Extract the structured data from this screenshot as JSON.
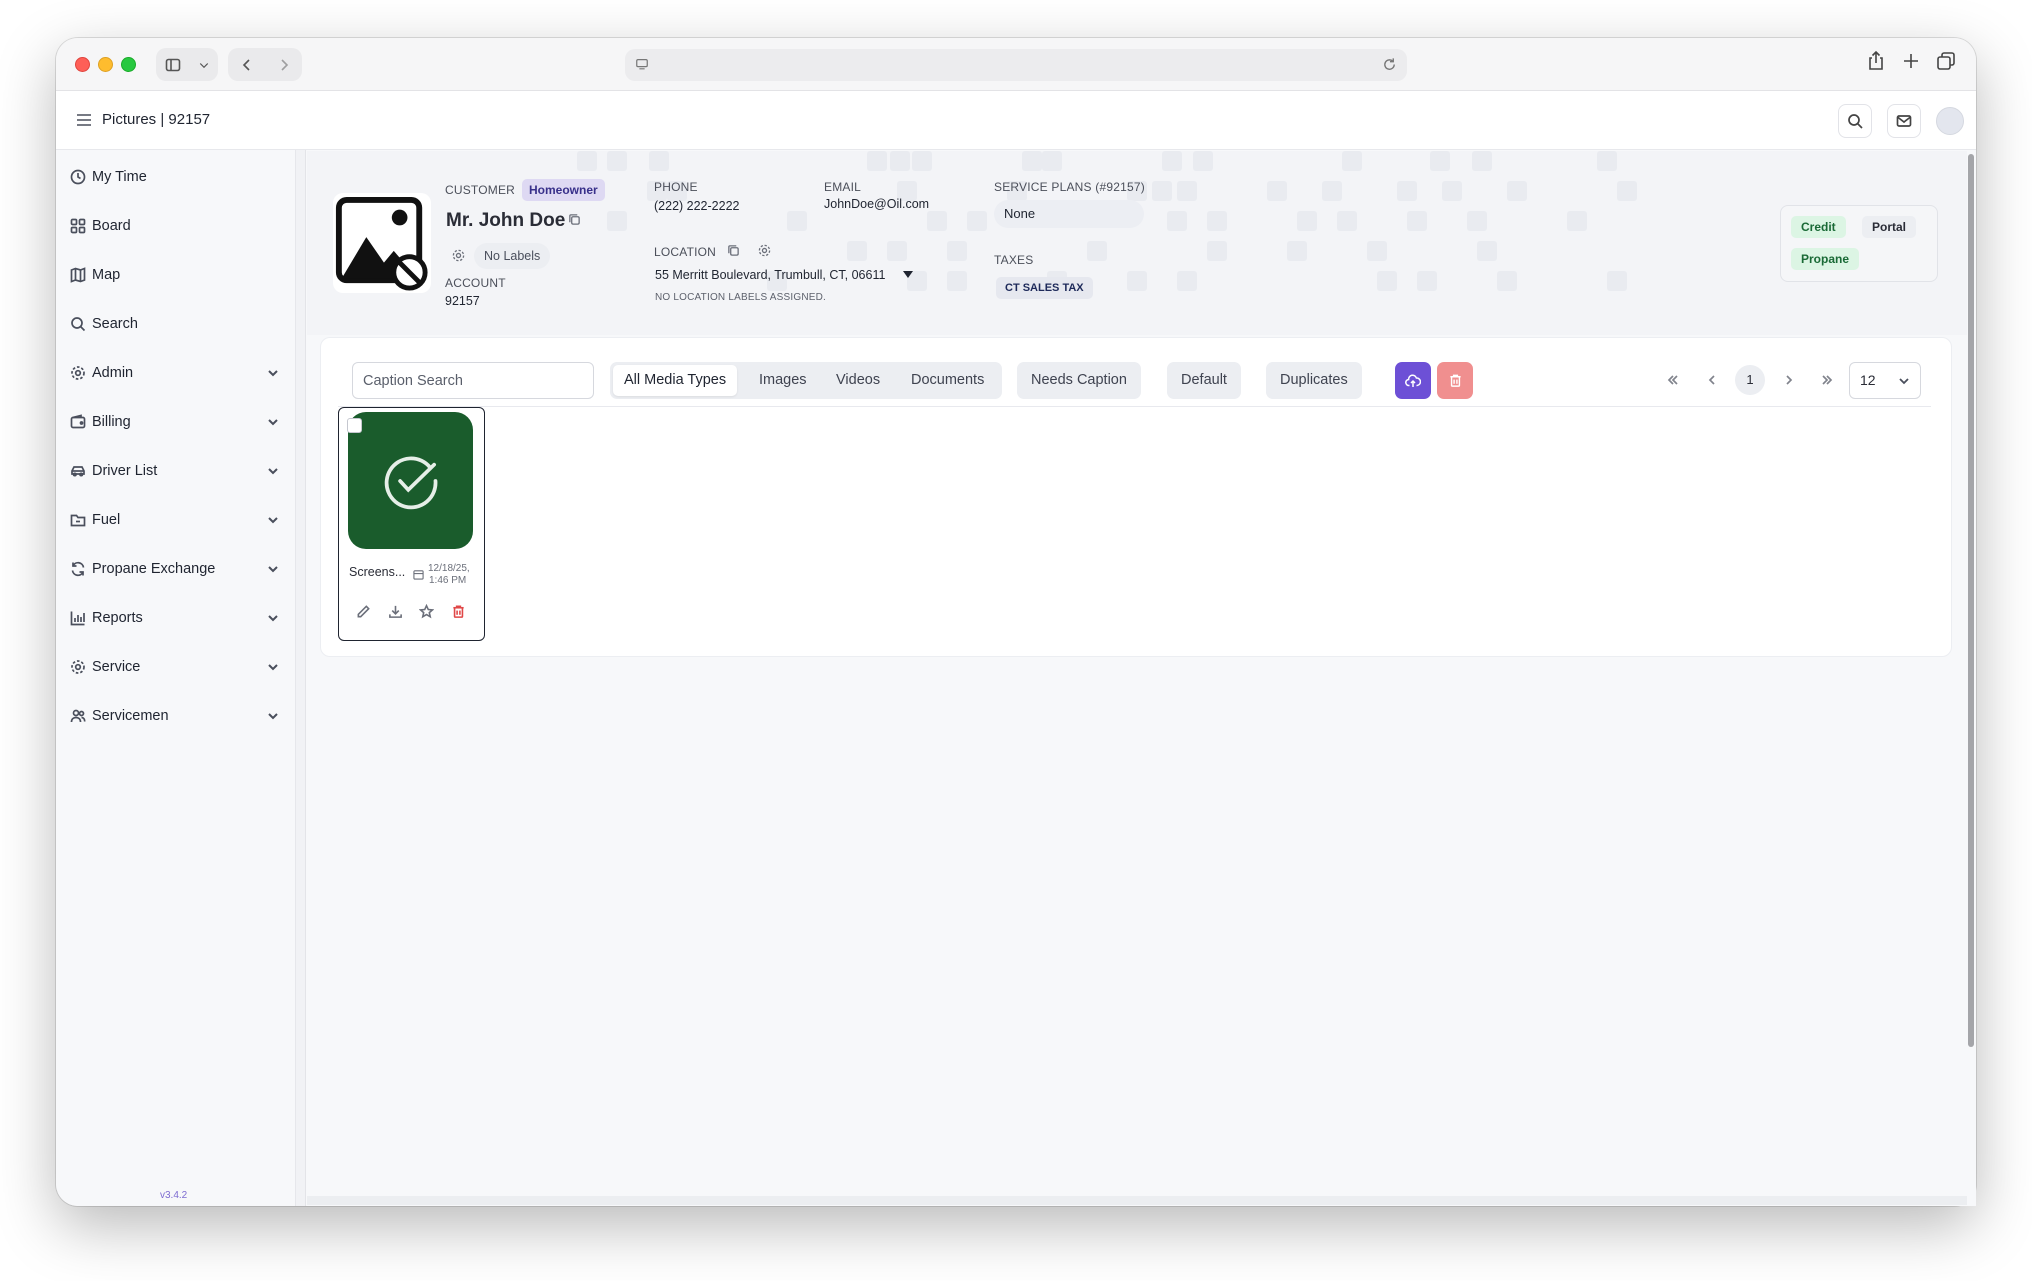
{
  "app": {
    "title": "Pictures | 92157",
    "version": "v3.4.2"
  },
  "sidebar": {
    "items": [
      {
        "label": "My Time",
        "icon": "clock-icon",
        "expandable": false
      },
      {
        "label": "Board",
        "icon": "grid-icon",
        "expandable": false
      },
      {
        "label": "Map",
        "icon": "map-icon",
        "expandable": false
      },
      {
        "label": "Search",
        "icon": "search-icon",
        "expandable": false
      },
      {
        "label": "Admin",
        "icon": "gear-icon",
        "expandable": true
      },
      {
        "label": "Billing",
        "icon": "wallet-icon",
        "expandable": true
      },
      {
        "label": "Driver List",
        "icon": "car-icon",
        "expandable": true
      },
      {
        "label": "Fuel",
        "icon": "folder-icon",
        "expandable": true
      },
      {
        "label": "Propane Exchange",
        "icon": "refresh-icon",
        "expandable": true
      },
      {
        "label": "Reports",
        "icon": "bar-chart-icon",
        "expandable": true
      },
      {
        "label": "Service",
        "icon": "gear-icon",
        "expandable": true
      },
      {
        "label": "Servicemen",
        "icon": "users-icon",
        "expandable": true
      }
    ]
  },
  "customer": {
    "label": "CUSTOMER",
    "type_badge": "Homeowner",
    "name": "Mr. John Doe",
    "labels": "No Labels",
    "account_label": "ACCOUNT",
    "account": "92157",
    "phone_label": "PHONE",
    "phone": "(222) 222-2222",
    "email_label": "EMAIL",
    "email": "JohnDoe@Oil.com",
    "location_label": "LOCATION",
    "location": "55 Merritt Boulevard, Trumbull, CT, 06611",
    "location_labels": "NO LOCATION LABELS ASSIGNED.",
    "service_plans_label": "SERVICE PLANS (#92157)",
    "service_plan": "None",
    "taxes_label": "TAXES",
    "tax": "CT SALES TAX",
    "status_pills": [
      "Credit",
      "Portal",
      "Propane"
    ]
  },
  "media": {
    "search_placeholder": "Caption Search",
    "type_tabs": [
      "All Media Types",
      "Images",
      "Videos",
      "Documents"
    ],
    "active_tab": "All Media Types",
    "filters": [
      "Needs Caption",
      "Default",
      "Duplicates"
    ],
    "pagination": {
      "page": "1",
      "page_size": "12"
    },
    "items": [
      {
        "name": "Screens...",
        "date": "12/18/25,",
        "time": "1:46 PM"
      }
    ]
  },
  "colors": {
    "accent": "#6d50d6",
    "danger": "#f08f8f",
    "thumb_green": "#1a5c2c",
    "success_bg": "#dcf5e4"
  }
}
